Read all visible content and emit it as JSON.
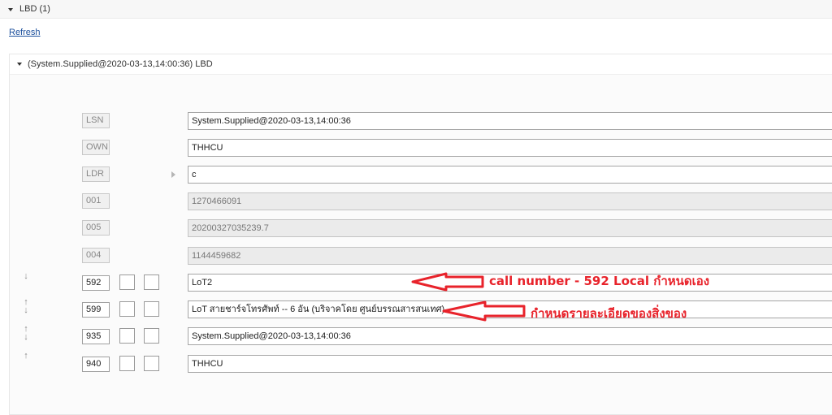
{
  "header": {
    "title": "LBD (1)"
  },
  "refresh_label": "Refresh",
  "panel": {
    "title": "(System.Supplied@2020-03-13,14:00:36) LBD"
  },
  "fixed_fields": [
    {
      "tag": "LSN",
      "value": "System.Supplied@2020-03-13,14:00:36",
      "readonly": false
    },
    {
      "tag": "OWN",
      "value": "THHCU",
      "readonly": false
    },
    {
      "tag": "LDR",
      "value": "c",
      "readonly": false
    },
    {
      "tag": "001",
      "value": "1270466091",
      "readonly": true
    },
    {
      "tag": "005",
      "value": "20200327035239.7",
      "readonly": true
    },
    {
      "tag": "004",
      "value": "1144459682",
      "readonly": true
    }
  ],
  "variable_fields": [
    {
      "tag": "592",
      "value": "LoT2",
      "ind1": "",
      "ind2": "",
      "move": "down-icon"
    },
    {
      "tag": "599",
      "value": "LoT สายชาร์จโทรศัพท์ -- 6 อัน (บริจาคโดย ศูนย์บรรณสารสนเทศ)",
      "ind1": "",
      "ind2": "",
      "move": "up-down-icon"
    },
    {
      "tag": "935",
      "value": "System.Supplied@2020-03-13,14:00:36",
      "ind1": "",
      "ind2": "",
      "move": "up-down-icon"
    },
    {
      "tag": "940",
      "value": "THHCU",
      "ind1": "",
      "ind2": "",
      "move": "up-icon"
    }
  ],
  "annotations": {
    "call_number": "call number -  592 Local กำหนดเอง",
    "details": "กำหนดรายละเอียดของสิ่งของ"
  },
  "colors": {
    "annotation": "#e8232b",
    "link": "#1b4f9c"
  }
}
